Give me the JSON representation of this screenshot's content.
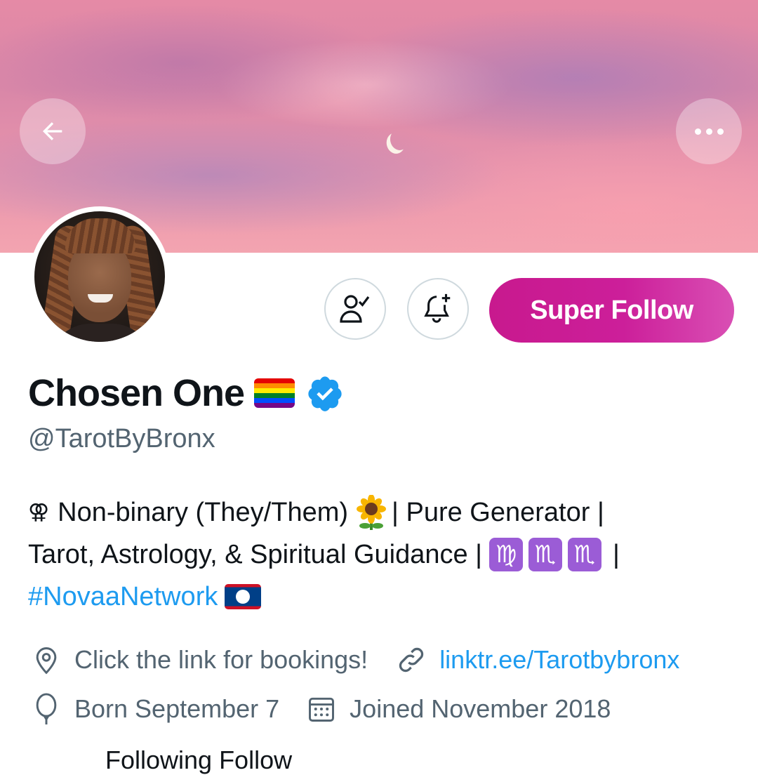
{
  "header": {
    "back_icon": "arrow-left-icon",
    "more_icon": "more-horizontal-icon"
  },
  "actions": {
    "follow_state_icon": "person-check-icon",
    "notify_icon": "bell-plus-icon",
    "super_follow_label": "Super Follow",
    "super_follow_color": "#c8198e"
  },
  "profile": {
    "display_name": "Chosen One",
    "handle": "@TarotByBronx",
    "verified": true,
    "name_emoji": "rainbow-flag"
  },
  "bio": {
    "line1_symbol": "⚢",
    "line1_text": "Non-binary (They/Them)",
    "line1_after_emoji": "| Pure Generator |",
    "line2_text": "Tarot, Astrology, & Spiritual Guidance |",
    "zodiac": [
      "♍",
      "♏",
      "♏"
    ],
    "line2_end": "|",
    "hashtag": "#NovaaNetwork",
    "flag_emoji": "belize-flag"
  },
  "meta": {
    "location": "Click the link for bookings!",
    "website": "linktr.ee/Tarotbybronx",
    "birthday": "Born September 7",
    "joined": "Joined November 2018"
  },
  "cutoff_text": "Following                    Follow"
}
